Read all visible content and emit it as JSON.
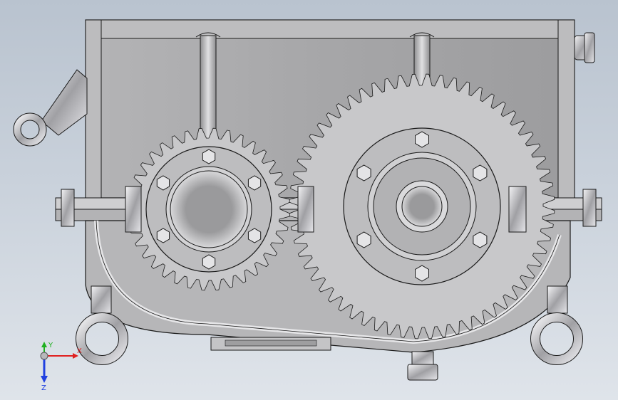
{
  "viewport": {
    "background_top": "#b9c3cf",
    "background_bottom": "#dfe4ea"
  },
  "model": {
    "name": "",
    "housing_color": "#a9a9ab",
    "housing_light": "#c4c4c6",
    "edge_color": "#1a1a1a",
    "gear_small_teeth": 36,
    "gear_large_teeth": 60
  },
  "triad": {
    "x_label": "X",
    "y_label": "Y",
    "z_label": "Z",
    "x_color": "#e02020",
    "y_color": "#20b020",
    "z_color": "#2040e0"
  }
}
